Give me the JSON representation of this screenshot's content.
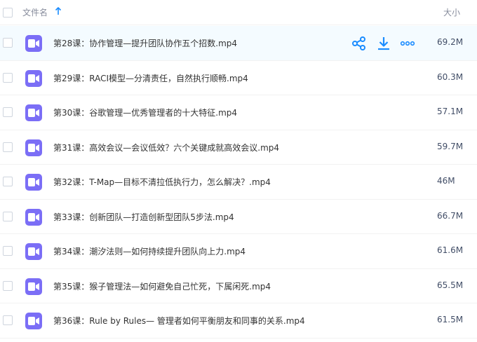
{
  "header": {
    "name_label": "文件名",
    "size_label": "大小",
    "sort_icon": "arrow-up-icon"
  },
  "files": [
    {
      "name": "第28课：协作管理—提升团队协作五个招数.mp4",
      "size": "69.2M"
    },
    {
      "name": "第29课：RACI模型—分清责任，自然执行顺畅.mp4",
      "size": "60.3M"
    },
    {
      "name": "第30课：谷歌管理—优秀管理者的十大特征.mp4",
      "size": "57.1M"
    },
    {
      "name": "第31课：高效会议—会议低效？六个关键成就高效会议.mp4",
      "size": "59.7M"
    },
    {
      "name": "第32课：T-Map—目标不清拉低执行力，怎么解决？.mp4",
      "size": "46M"
    },
    {
      "name": "第33课：创新团队—打造创新型团队5步法.mp4",
      "size": "66.7M"
    },
    {
      "name": "第34课：潮汐法则—如何持续提升团队向上力.mp4",
      "size": "61.6M"
    },
    {
      "name": "第35课：猴子管理法—如何避免自己忙死，下属闲死.mp4",
      "size": "65.5M"
    },
    {
      "name": "第36课：Rule by Rules— 管理者如何平衡朋友和同事的关系.mp4",
      "size": "61.5M"
    }
  ],
  "row_actions": {
    "share_icon": "share-icon",
    "download_icon": "download-icon",
    "more_icon": "more-icon"
  },
  "colors": {
    "accent": "#1a8cff",
    "video_icon": "#7b6ef6",
    "selected_row_bg": "#f4fbff"
  }
}
